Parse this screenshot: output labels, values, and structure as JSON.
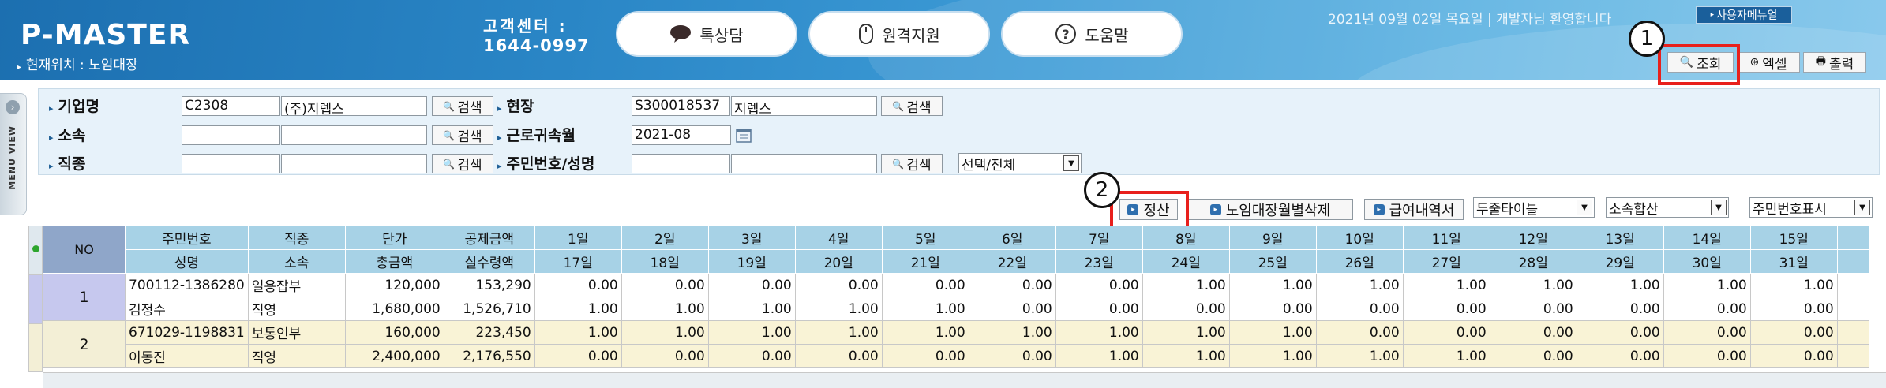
{
  "header": {
    "brand": "P-MASTER",
    "location_prefix": "현재위치 : ",
    "location": "노임대장",
    "cs_title": "고객센터 :",
    "cs_phone": "1644-0997",
    "buttons": [
      {
        "label": "톡상담",
        "icon": "chat-bubble-icon"
      },
      {
        "label": "원격지원",
        "icon": "mouse-icon"
      },
      {
        "label": "도움말",
        "icon": "help-circle-icon"
      }
    ],
    "info": "2021년 09월 02일 목요일 | 개발자님 환영합니다",
    "user_menu": "사용자메뉴얼",
    "tools": {
      "search": "조회",
      "excel": "엑셀",
      "print": "출력"
    }
  },
  "side_menu": {
    "label": "MENU VIEW"
  },
  "callouts": [
    "1",
    "2"
  ],
  "search": {
    "company_label": "기업명",
    "company_code": "C2308",
    "company_name": "(주)지렙스",
    "site_label": "현장",
    "site_code": "S300018537",
    "site_name": "지렙스",
    "dept_label": "소속",
    "dept_code": "",
    "dept_name": "",
    "work_month_label": "근로귀속월",
    "work_month": "2021-08",
    "job_label": "직종",
    "job_code": "",
    "job_name": "",
    "resident_label": "주민번호/성명",
    "resident_no": "",
    "resident_name": "",
    "search_btn": "검색",
    "select_value": "선택/전체"
  },
  "actions": {
    "settle": "정산",
    "delete_monthly": "노임대장월별삭제",
    "payslip": "급여내역서",
    "title_select": "두줄타이틀",
    "dept_total_select": "소속합산",
    "resident_show_select": "주민번호표시"
  },
  "table": {
    "header_row1": [
      "NO",
      "주민번호",
      "직종",
      "단가",
      "공제금액",
      "1일",
      "2일",
      "3일",
      "4일",
      "5일",
      "6일",
      "7일",
      "8일",
      "9일",
      "10일",
      "11일",
      "12일",
      "13일",
      "14일",
      "15일"
    ],
    "header_row2": [
      "성명",
      "소속",
      "총금액",
      "실수령액",
      "17일",
      "18일",
      "19일",
      "20일",
      "21일",
      "22일",
      "23일",
      "24일",
      "25일",
      "26일",
      "27일",
      "28일",
      "29일",
      "30일",
      "31일"
    ],
    "rows": [
      {
        "no": "1",
        "line1": {
          "resident": "700112-1386280",
          "job": "일용잡부",
          "price": "120,000",
          "deduct": "153,290",
          "days": [
            "0.00",
            "0.00",
            "0.00",
            "0.00",
            "0.00",
            "0.00",
            "0.00",
            "1.00",
            "1.00",
            "1.00",
            "1.00",
            "1.00",
            "1.00",
            "1.00",
            "1.00"
          ]
        },
        "line2": {
          "name": "김정수",
          "dept": "직영",
          "total": "1,680,000",
          "net": "1,526,710",
          "days": [
            "1.00",
            "1.00",
            "1.00",
            "1.00",
            "1.00",
            "0.00",
            "0.00",
            "0.00",
            "0.00",
            "0.00",
            "0.00",
            "0.00",
            "0.00",
            "0.00",
            "0.00"
          ]
        }
      },
      {
        "no": "2",
        "line1": {
          "resident": "671029-1198831",
          "job": "보통인부",
          "price": "160,000",
          "deduct": "223,450",
          "days": [
            "1.00",
            "1.00",
            "1.00",
            "1.00",
            "1.00",
            "1.00",
            "1.00",
            "1.00",
            "1.00",
            "0.00",
            "0.00",
            "0.00",
            "0.00",
            "0.00",
            "0.00"
          ]
        },
        "line2": {
          "name": "이동진",
          "dept": "직영",
          "total": "2,400,000",
          "net": "2,176,550",
          "days": [
            "0.00",
            "0.00",
            "0.00",
            "0.00",
            "0.00",
            "0.00",
            "1.00",
            "1.00",
            "1.00",
            "1.00",
            "1.00",
            "0.00",
            "0.00",
            "0.00",
            "0.00"
          ]
        }
      }
    ]
  }
}
